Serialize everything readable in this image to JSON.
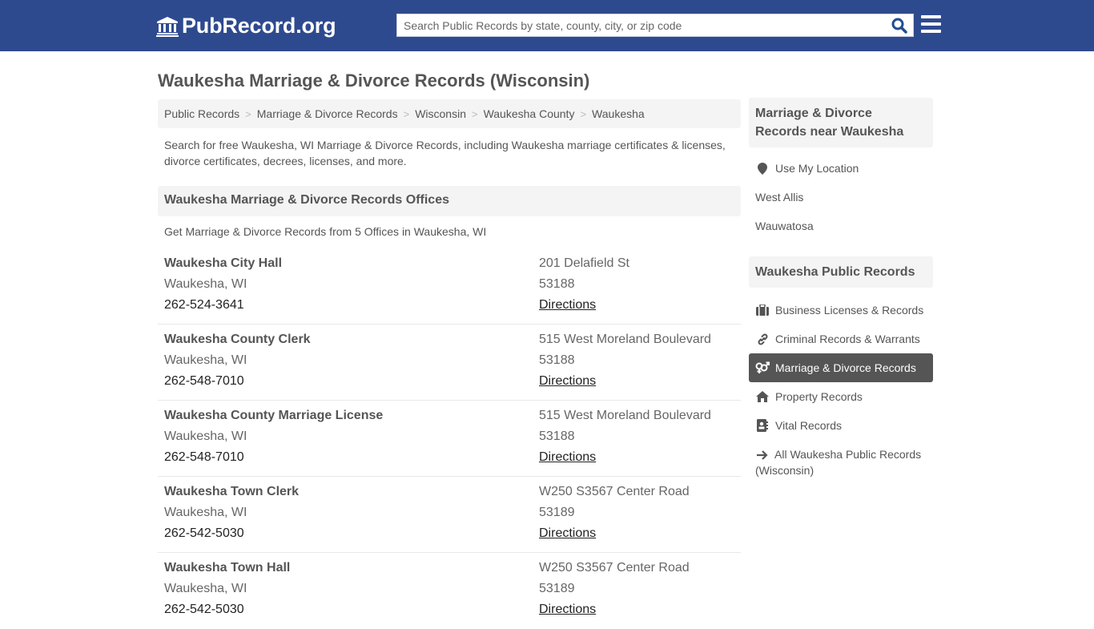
{
  "header": {
    "logo_text": "PubRecord.org",
    "logo_icon": "courthouse-icon",
    "search_placeholder": "Search Public Records by state, county, city, or zip code",
    "search_value": "",
    "search_icon": "search-icon",
    "menu_icon": "hamburger-menu-icon",
    "brand_color": "#2e4a8f"
  },
  "page": {
    "title": "Waukesha Marriage & Divorce Records (Wisconsin)"
  },
  "breadcrumb": [
    {
      "label": "Public Records"
    },
    {
      "label": "Marriage & Divorce Records"
    },
    {
      "label": "Wisconsin"
    },
    {
      "label": "Waukesha County"
    },
    {
      "label": "Waukesha"
    }
  ],
  "breadcrumb_separator": ">",
  "intro": "Search for free Waukesha, WI Marriage & Divorce Records, including Waukesha marriage certificates & licenses, divorce certificates, decrees, licenses, and more.",
  "offices_section": {
    "heading": "Waukesha Marriage & Divorce Records Offices",
    "subheading": "Get Marriage & Divorce Records from 5 Offices in Waukesha, WI",
    "offices": [
      {
        "name": "Waukesha City Hall",
        "city": "Waukesha, WI",
        "phone": "262-524-3641",
        "address": "201 Delafield St",
        "zip": "53188",
        "directions": "Directions"
      },
      {
        "name": "Waukesha County Clerk",
        "city": "Waukesha, WI",
        "phone": "262-548-7010",
        "address": "515 West Moreland Boulevard",
        "zip": "53188",
        "directions": "Directions"
      },
      {
        "name": "Waukesha County Marriage License",
        "city": "Waukesha, WI",
        "phone": "262-548-7010",
        "address": "515 West Moreland Boulevard",
        "zip": "53188",
        "directions": "Directions"
      },
      {
        "name": "Waukesha Town Clerk",
        "city": "Waukesha, WI",
        "phone": "262-542-5030",
        "address": "W250 S3567 Center Road",
        "zip": "53189",
        "directions": "Directions"
      },
      {
        "name": "Waukesha Town Hall",
        "city": "Waukesha, WI",
        "phone": "262-542-5030",
        "address": "W250 S3567 Center Road",
        "zip": "53189",
        "directions": "Directions"
      }
    ]
  },
  "sidebar": {
    "near": {
      "heading": "Marriage & Divorce Records near Waukesha",
      "items": [
        {
          "label": "Use My Location",
          "icon": "map-marker-icon"
        },
        {
          "label": "West Allis"
        },
        {
          "label": "Wauwatosa"
        }
      ]
    },
    "public_records": {
      "heading": "Waukesha Public Records",
      "items": [
        {
          "label": "Business Licenses & Records",
          "icon": "briefcase-icon",
          "active": false
        },
        {
          "label": "Criminal Records & Warrants",
          "icon": "link-icon",
          "active": false
        },
        {
          "label": "Marriage & Divorce Records",
          "icon": "venus-mars-icon",
          "active": true
        },
        {
          "label": "Property Records",
          "icon": "home-icon",
          "active": false
        },
        {
          "label": "Vital Records",
          "icon": "address-book-icon",
          "active": false
        },
        {
          "label": "All Waukesha Public Records (Wisconsin)",
          "icon": "arrow-right-icon",
          "active": false
        }
      ],
      "active_bg": "#555555"
    }
  }
}
